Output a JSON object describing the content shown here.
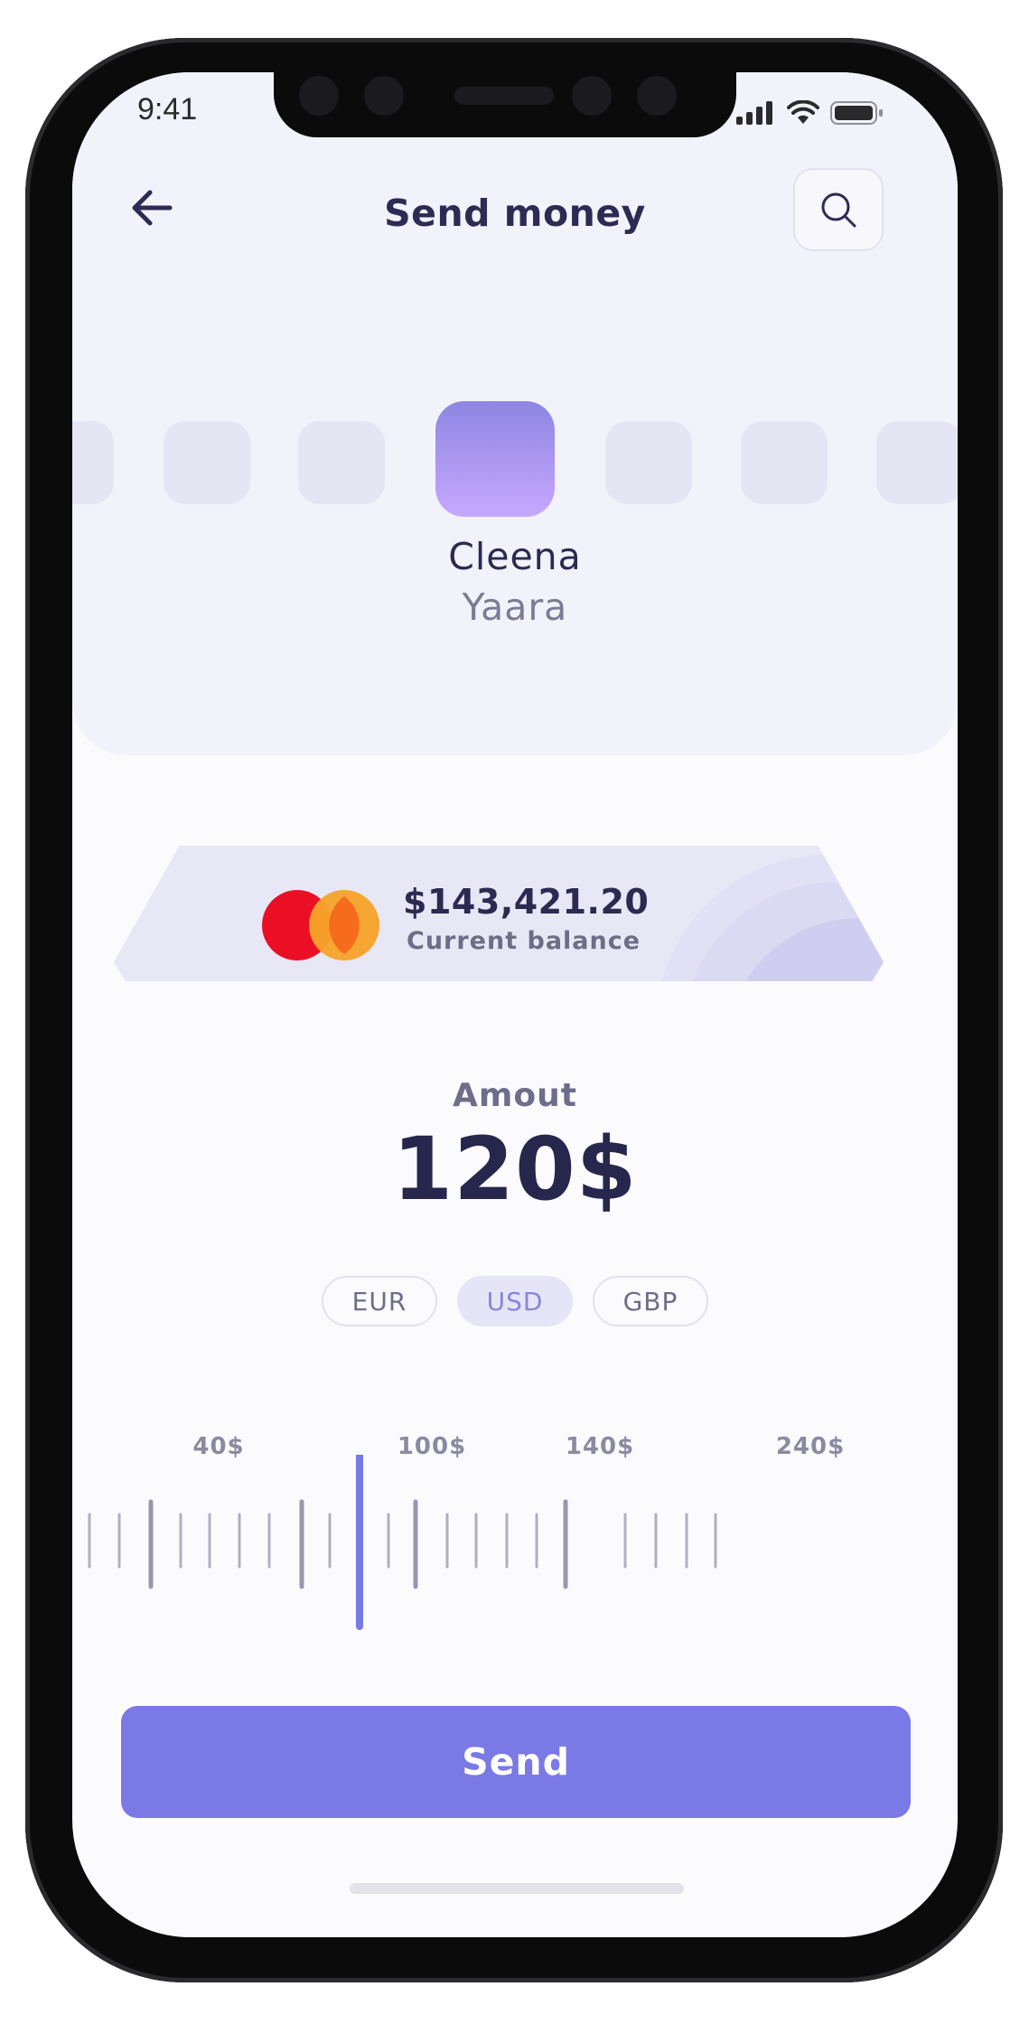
{
  "status_bar": {
    "time": "9:41"
  },
  "header": {
    "title": "Send money"
  },
  "recipient": {
    "first_name": "Cleena",
    "last_name": "Yaara"
  },
  "card": {
    "balance": "$143,421.20",
    "balance_label": "Current balance"
  },
  "amount": {
    "label": "Amout",
    "value": "120$"
  },
  "currencies": {
    "eur": "EUR",
    "usd": "USD",
    "gbp": "GBP",
    "selected": "USD"
  },
  "slider": {
    "labels": [
      "40$",
      "100$",
      "140$",
      "240$"
    ],
    "current_value": 120
  },
  "send_button": {
    "label": "Send"
  },
  "colors": {
    "accent": "#7a79e6",
    "title": "#2d2b54",
    "card": "#e8e7f6",
    "panel": "#f2f2fa"
  },
  "icons": {
    "back": "arrow-left-icon",
    "search": "search-icon",
    "signal": "signal-icon",
    "wifi": "wifi-icon",
    "battery": "battery-icon",
    "card_logo": "mastercard-logo"
  }
}
